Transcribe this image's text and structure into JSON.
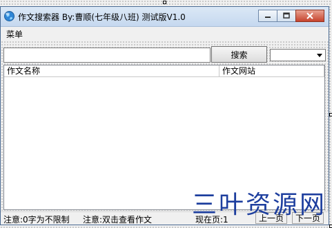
{
  "window": {
    "title": "作文搜索器 By:曹顺(七年级八班) 测试版V1.0"
  },
  "menu": {
    "items": [
      "菜单"
    ]
  },
  "search": {
    "input_value": "",
    "button_label": "搜索",
    "dropdown_value": ""
  },
  "list": {
    "columns": [
      "作文名称",
      "作文网站"
    ],
    "rows": []
  },
  "status": {
    "note1": "注意:0字为不限制",
    "note2": "注意:双击查看作文",
    "page_label": "现在页:1",
    "prev_label": "上一页",
    "next_label": "下一页"
  },
  "watermark": "三叶资源网",
  "colors": {
    "watermark": "#1d3e9e",
    "close_button": "#c7432d"
  }
}
